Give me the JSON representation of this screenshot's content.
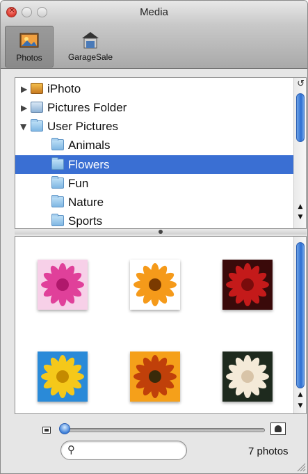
{
  "window": {
    "title": "Media"
  },
  "toolbar": {
    "items": [
      {
        "label": "Photos",
        "icon": "photos-icon",
        "selected": true
      },
      {
        "label": "GarageSale",
        "icon": "garagesale-icon",
        "selected": false
      }
    ]
  },
  "sources": {
    "items": [
      {
        "label": "iPhoto",
        "icon": "iphoto-icon",
        "disclosure": "collapsed"
      },
      {
        "label": "Pictures Folder",
        "icon": "pictures-folder-icon",
        "disclosure": "collapsed"
      },
      {
        "label": "User Pictures",
        "icon": "folder-icon",
        "disclosure": "expanded"
      },
      {
        "label": "Animals",
        "icon": "folder-icon"
      },
      {
        "label": "Flowers",
        "icon": "folder-icon",
        "selected": true
      },
      {
        "label": "Fun",
        "icon": "folder-icon"
      },
      {
        "label": "Nature",
        "icon": "folder-icon"
      },
      {
        "label": "Sports",
        "icon": "folder-icon"
      }
    ]
  },
  "photos": [
    {
      "subject": "pink flower",
      "colors": [
        "#f7d0e8",
        "#e0409a",
        "#b0186c"
      ]
    },
    {
      "subject": "orange gerbera",
      "colors": [
        "#ffffff",
        "#f59a1a",
        "#7a3a00"
      ]
    },
    {
      "subject": "red rose",
      "colors": [
        "#3a0a0a",
        "#c41a1a",
        "#7a0c0c"
      ]
    },
    {
      "subject": "sunflower",
      "colors": [
        "#2a8ad8",
        "#f5c81a",
        "#c48a00"
      ]
    },
    {
      "subject": "orange lily",
      "colors": [
        "#f5a01a",
        "#c0400a",
        "#3a2a0a"
      ]
    },
    {
      "subject": "white rose",
      "colors": [
        "#1e2a1e",
        "#f4ead8",
        "#d8c4a8"
      ]
    }
  ],
  "footer": {
    "photo_count": "7 photos",
    "search_placeholder": "",
    "thumbnail_size": 0.0
  },
  "colors": {
    "selection": "#3a6fd3",
    "scroll_thumb": "#2c6ed1"
  }
}
